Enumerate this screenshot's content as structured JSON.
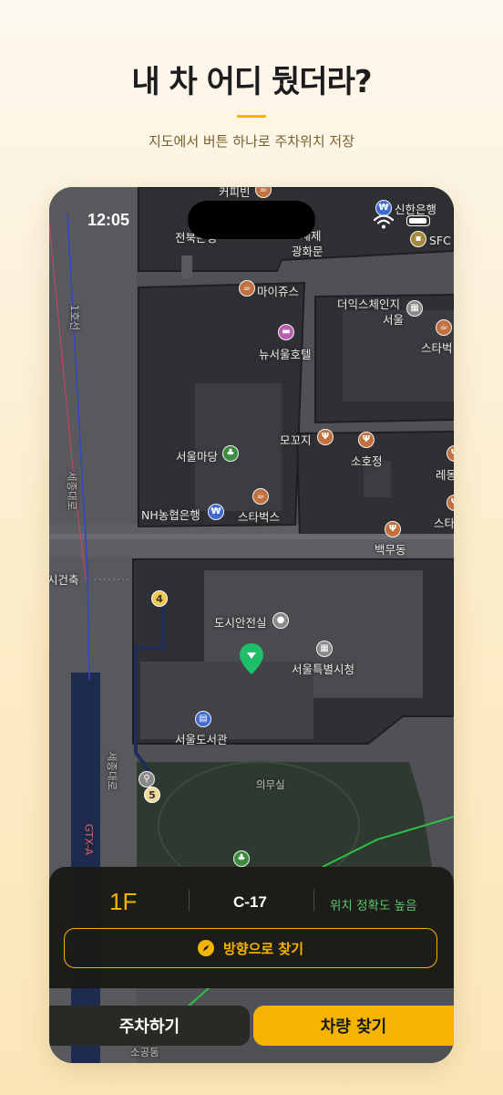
{
  "hero": {
    "title": "내 차 어디 뒀더라?",
    "subtitle": "지도에서 버튼 하나로 주차위치 저장"
  },
  "status_bar": {
    "time": "12:05"
  },
  "map": {
    "labels": {
      "top_cut": "커피빈",
      "jeonbuk": "전북은행",
      "gwanghwamun": "광화문",
      "seje": "ㅡ세제",
      "shinhan": "신한은행",
      "sfc": "SFC",
      "maijus": "마이쥬스",
      "the_ik": "더익스체인지",
      "seoul": "서울",
      "starbucks_right": "스타벅",
      "new_seoul_hotel": "뉴서울호텔",
      "line1": "1호선",
      "sejongdaero": "세종대로",
      "seoul_madang": "서울마당",
      "mokkoji": "모꼬지",
      "sohojeong": "소호정",
      "lemong": "레몽",
      "nh_bank": "NH농협은행",
      "starbucks": "스타벅스",
      "star_right2": "스타",
      "baekmudong": "백무동",
      "sigan": "시건축",
      "dosi": "도시안전실",
      "city_hall": "서울특별시청",
      "library": "서울도서관",
      "sejongdaero2": "세종대로",
      "uimusil": "의무실",
      "gtx": "GTX-A",
      "sogong": "소공동"
    },
    "subway_exits": [
      "4",
      "5"
    ]
  },
  "parking": {
    "floor": "1F",
    "spot": "C-17",
    "accuracy": "위치 정확도 높음",
    "direction_button": "방향으로 찾기"
  },
  "tabs": {
    "park": "주차하기",
    "find": "차량 찾기"
  },
  "colors": {
    "accent": "#f5b400",
    "success": "#59c96b",
    "map_background": "#3a3b3f",
    "pin": "#1fbf6a"
  }
}
